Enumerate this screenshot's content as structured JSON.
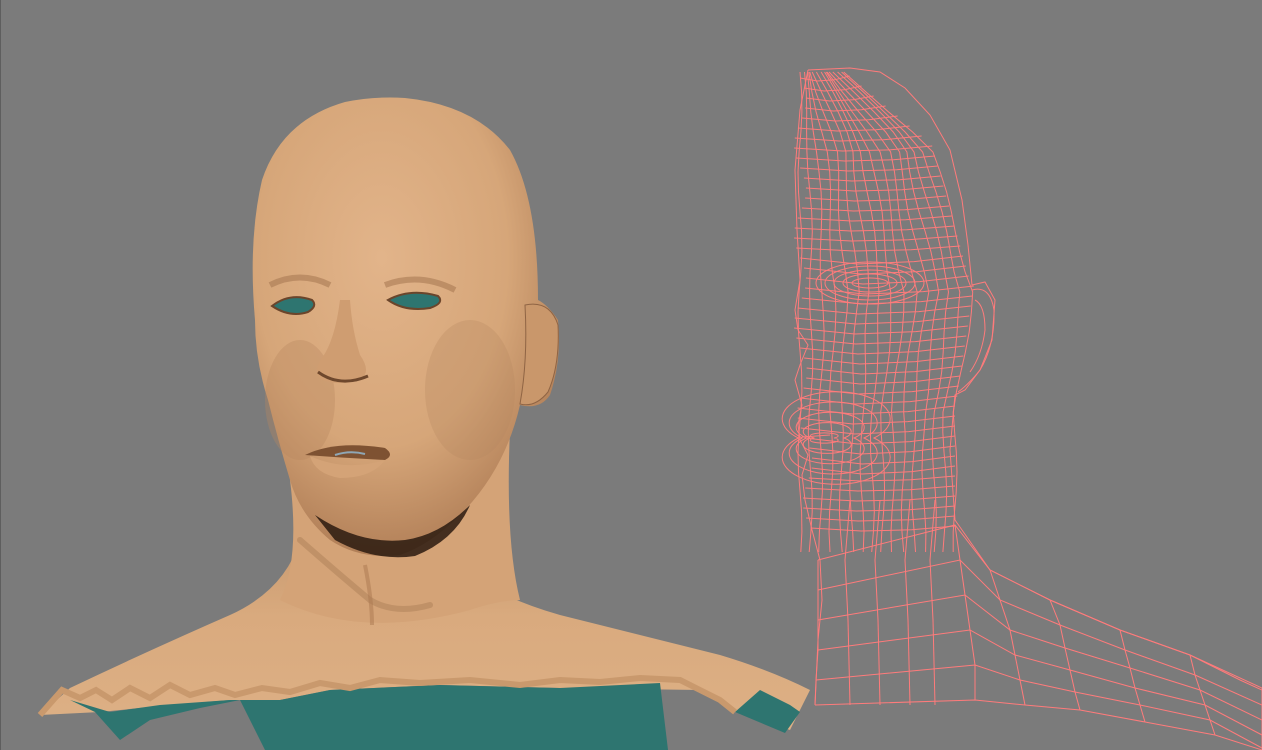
{
  "viewport": {
    "background_color": "#7b7b7b"
  },
  "shaded_model": {
    "skin_color": "#d8a77c",
    "skin_shadow_color": "#7a5232",
    "interior_color": "#2e7570"
  },
  "wireframe_model": {
    "wire_color": "#ff7b7b"
  }
}
